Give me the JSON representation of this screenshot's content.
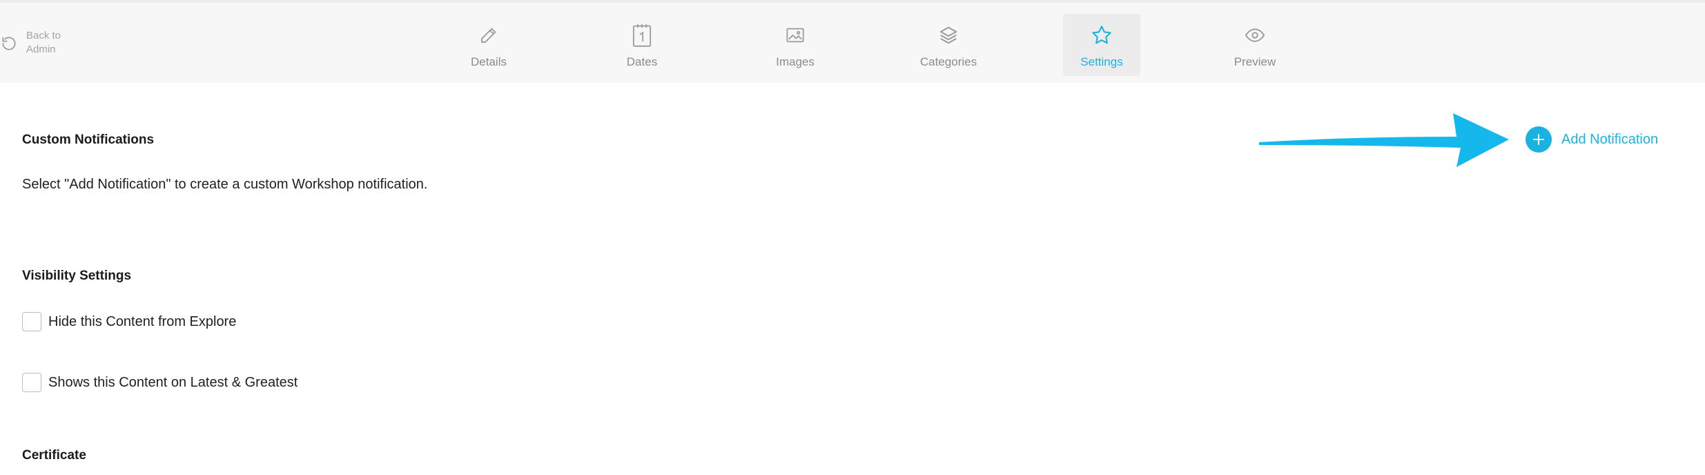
{
  "nav": {
    "back_label_line1": "Back to",
    "back_label_line2": "Admin",
    "tabs": [
      {
        "label": "Details",
        "icon": "pencil-icon"
      },
      {
        "label": "Dates",
        "icon": "calendar-icon"
      },
      {
        "label": "Images",
        "icon": "image-icon"
      },
      {
        "label": "Categories",
        "icon": "layers-icon"
      },
      {
        "label": "Settings",
        "icon": "star-icon",
        "active": true
      },
      {
        "label": "Preview",
        "icon": "eye-icon"
      }
    ]
  },
  "notifications": {
    "title": "Custom Notifications",
    "description": "Select \"Add Notification\" to create a custom Workshop notification.",
    "add_label": "Add Notification"
  },
  "visibility": {
    "title": "Visibility Settings",
    "options": [
      {
        "label": "Hide this Content from Explore",
        "checked": false
      },
      {
        "label": "Shows this Content on Latest & Greatest",
        "checked": false
      }
    ]
  },
  "certificate": {
    "title": "Certificate"
  },
  "colors": {
    "accent": "#1ab2e0",
    "nav_bg": "#f7f7f7",
    "muted_text": "#8b8b8b"
  }
}
